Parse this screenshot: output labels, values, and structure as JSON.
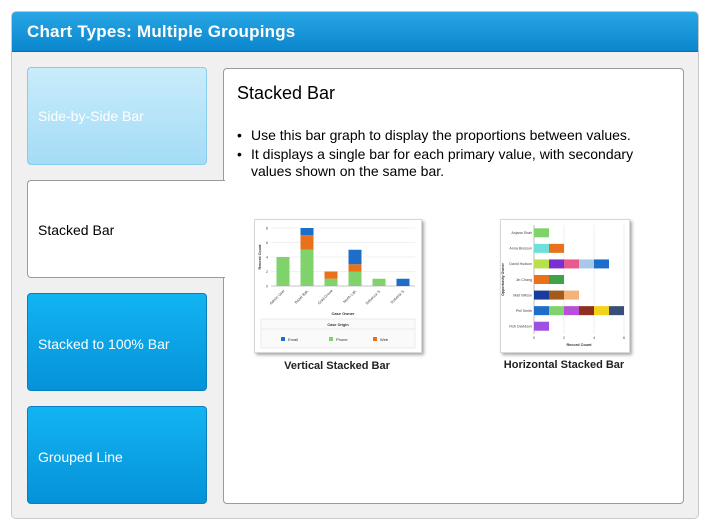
{
  "header": {
    "title": "Chart Types: Multiple Groupings"
  },
  "tabs": [
    {
      "label": "Side-by-Side Bar",
      "state": "visited"
    },
    {
      "label": "Stacked Bar",
      "state": "active"
    },
    {
      "label": "Stacked to 100% Bar",
      "state": "default"
    },
    {
      "label": "Grouped Line",
      "state": "default"
    }
  ],
  "content": {
    "title": "Stacked Bar",
    "bullets": [
      "Use this bar graph to display the proportions between values.",
      "It displays a single bar for each primary value, with secondary values shown on the same bar."
    ]
  },
  "colors": {
    "header": "#1a97d9",
    "tab_active_blue": "#0aa2e6",
    "tab_visited": "#b6e4f9",
    "email": "#1c6ec8",
    "phone": "#7fd36a",
    "web": "#e8711a"
  },
  "chart_data": [
    {
      "type": "bar",
      "stacked": true,
      "orientation": "vertical",
      "caption": "Vertical Stacked Bar",
      "xlabel": "Case Owner",
      "ylabel": "Record Count",
      "ylim": [
        0,
        8
      ],
      "yticks": [
        "0",
        "2",
        "4",
        "6",
        "8"
      ],
      "categories": [
        "Admin User",
        "Bazel Bak.",
        "Gold Grove",
        "North Lak.",
        "Rebecca S.",
        "Roberta S."
      ],
      "legend_title": "Case Origin",
      "series": [
        {
          "name": "Phone",
          "color": "#7fd36a",
          "values": [
            4,
            5,
            1,
            2,
            1,
            0
          ]
        },
        {
          "name": "Web",
          "color": "#e8711a",
          "values": [
            0,
            2,
            1,
            1,
            0,
            0
          ]
        },
        {
          "name": "Email",
          "color": "#1c6ec8",
          "values": [
            0,
            1,
            0,
            2,
            0,
            1
          ]
        }
      ],
      "legend_order": [
        "Email",
        "Phone",
        "Web"
      ],
      "grid": true,
      "legend_position": "bottom"
    },
    {
      "type": "bar",
      "stacked": true,
      "orientation": "horizontal",
      "caption": "Horizontal Stacked Bar",
      "xlabel": "Record Count",
      "ylabel": "Opportunity Owner",
      "xlim": [
        0,
        6
      ],
      "xticks": [
        "0",
        "2",
        "4",
        "6"
      ],
      "categories": [
        "Anjana Shah",
        "Anna Bresson",
        "David Hudson",
        "Jin Chang",
        "Matt Wilson",
        "Phil Smith",
        "Rob Davidson"
      ],
      "segments": [
        [
          {
            "value": 1,
            "color": "#7fd36a"
          }
        ],
        [
          {
            "value": 1,
            "color": "#6fe0d9"
          },
          {
            "value": 1,
            "color": "#e8711a"
          }
        ],
        [
          {
            "value": 1,
            "color": "#b8e04a"
          },
          {
            "value": 1,
            "color": "#7a2fd0"
          },
          {
            "value": 1,
            "color": "#e9588f"
          },
          {
            "value": 1,
            "color": "#a8c8e8"
          },
          {
            "value": 1,
            "color": "#1c6ec8"
          }
        ],
        [
          {
            "value": 1,
            "color": "#e8711a"
          },
          {
            "value": 1,
            "color": "#3fa14a"
          }
        ],
        [
          {
            "value": 1,
            "color": "#1a3c9c"
          },
          {
            "value": 1,
            "color": "#a35a1a"
          },
          {
            "value": 1,
            "color": "#f2b27a"
          }
        ],
        [
          {
            "value": 1,
            "color": "#1c6ec8"
          },
          {
            "value": 1,
            "color": "#7fd36a"
          },
          {
            "value": 1,
            "color": "#b84fd8"
          },
          {
            "value": 1,
            "color": "#8e2f1f"
          },
          {
            "value": 1,
            "color": "#f2d21a"
          },
          {
            "value": 1,
            "color": "#3a4e7a"
          }
        ],
        [
          {
            "value": 1,
            "color": "#a050e0"
          }
        ]
      ],
      "grid": true
    }
  ]
}
